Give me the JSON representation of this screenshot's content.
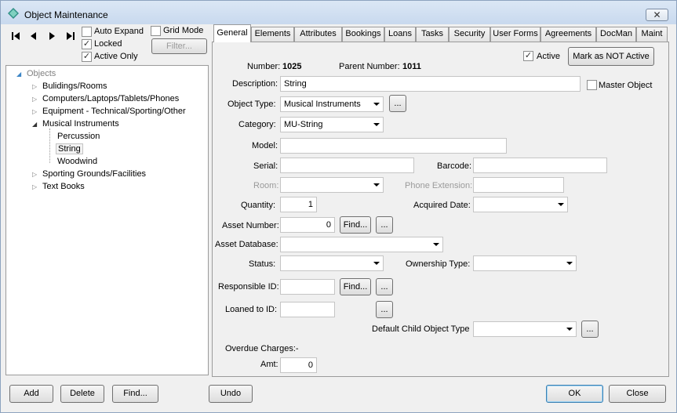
{
  "window": {
    "title": "Object Maintenance",
    "close_label": "✕"
  },
  "nav": {
    "first": "first-record-icon",
    "prev": "previous-record-icon",
    "next": "next-record-icon",
    "last": "last-record-icon"
  },
  "options": {
    "auto_expand": {
      "label": "Auto Expand",
      "checked": false
    },
    "locked": {
      "label": "Locked",
      "checked": true
    },
    "active_only": {
      "label": "Active Only",
      "checked": true
    },
    "grid_mode": {
      "label": "Grid Mode",
      "checked": false
    },
    "filter_label": "Filter..."
  },
  "tree": {
    "root": "Objects",
    "items": [
      {
        "label": "Bulidings/Rooms",
        "expanded": false
      },
      {
        "label": "Computers/Laptops/Tablets/Phones",
        "expanded": false
      },
      {
        "label": "Equipment - Technical/Sporting/Other",
        "expanded": false
      },
      {
        "label": "Musical Instruments",
        "expanded": true
      },
      {
        "label": "Percussion",
        "child": true
      },
      {
        "label": "String",
        "child": true,
        "selected": true
      },
      {
        "label": "Woodwind",
        "child": true
      },
      {
        "label": "Sporting Grounds/Facilities",
        "expanded": false
      },
      {
        "label": "Text Books",
        "expanded": false
      }
    ]
  },
  "tabs": [
    "General",
    "Elements",
    "Attributes",
    "Bookings",
    "Loans",
    "Tasks",
    "Security",
    "User Forms",
    "Agreements",
    "DocMan",
    "Maint"
  ],
  "general": {
    "active_label": "Active",
    "active_checked": true,
    "mark_not_active": "Mark as NOT Active",
    "number_label": "Number:",
    "number_value": "1025",
    "parent_number_label": "Parent Number:",
    "parent_number_value": "1011",
    "description_label": "Description:",
    "description_value": "String",
    "master_object_label": "Master Object",
    "object_type_label": "Object Type:",
    "object_type_value": "Musical Instruments",
    "category_label": "Category:",
    "category_value": "MU-String",
    "model_label": "Model:",
    "serial_label": "Serial:",
    "barcode_label": "Barcode:",
    "room_label": "Room:",
    "phone_ext_label": "Phone Extension:",
    "quantity_label": "Quantity:",
    "quantity_value": "1",
    "acquired_date_label": "Acquired Date:",
    "asset_number_label": "Asset Number:",
    "asset_number_value": "0",
    "find_label": "Find...",
    "ellipsis": "...",
    "asset_db_label": "Asset Database:",
    "status_label": "Status:",
    "ownership_label": "Ownership Type:",
    "responsible_label": "Responsible ID:",
    "loaned_label": "Loaned to ID:",
    "default_child_label": "Default Child Object Type",
    "overdue_label": "Overdue Charges:-",
    "amt_label": "Amt:",
    "amt_value": "0"
  },
  "footer": {
    "add": "Add",
    "delete": "Delete",
    "find": "Find...",
    "undo": "Undo",
    "ok": "OK",
    "close": "Close"
  }
}
